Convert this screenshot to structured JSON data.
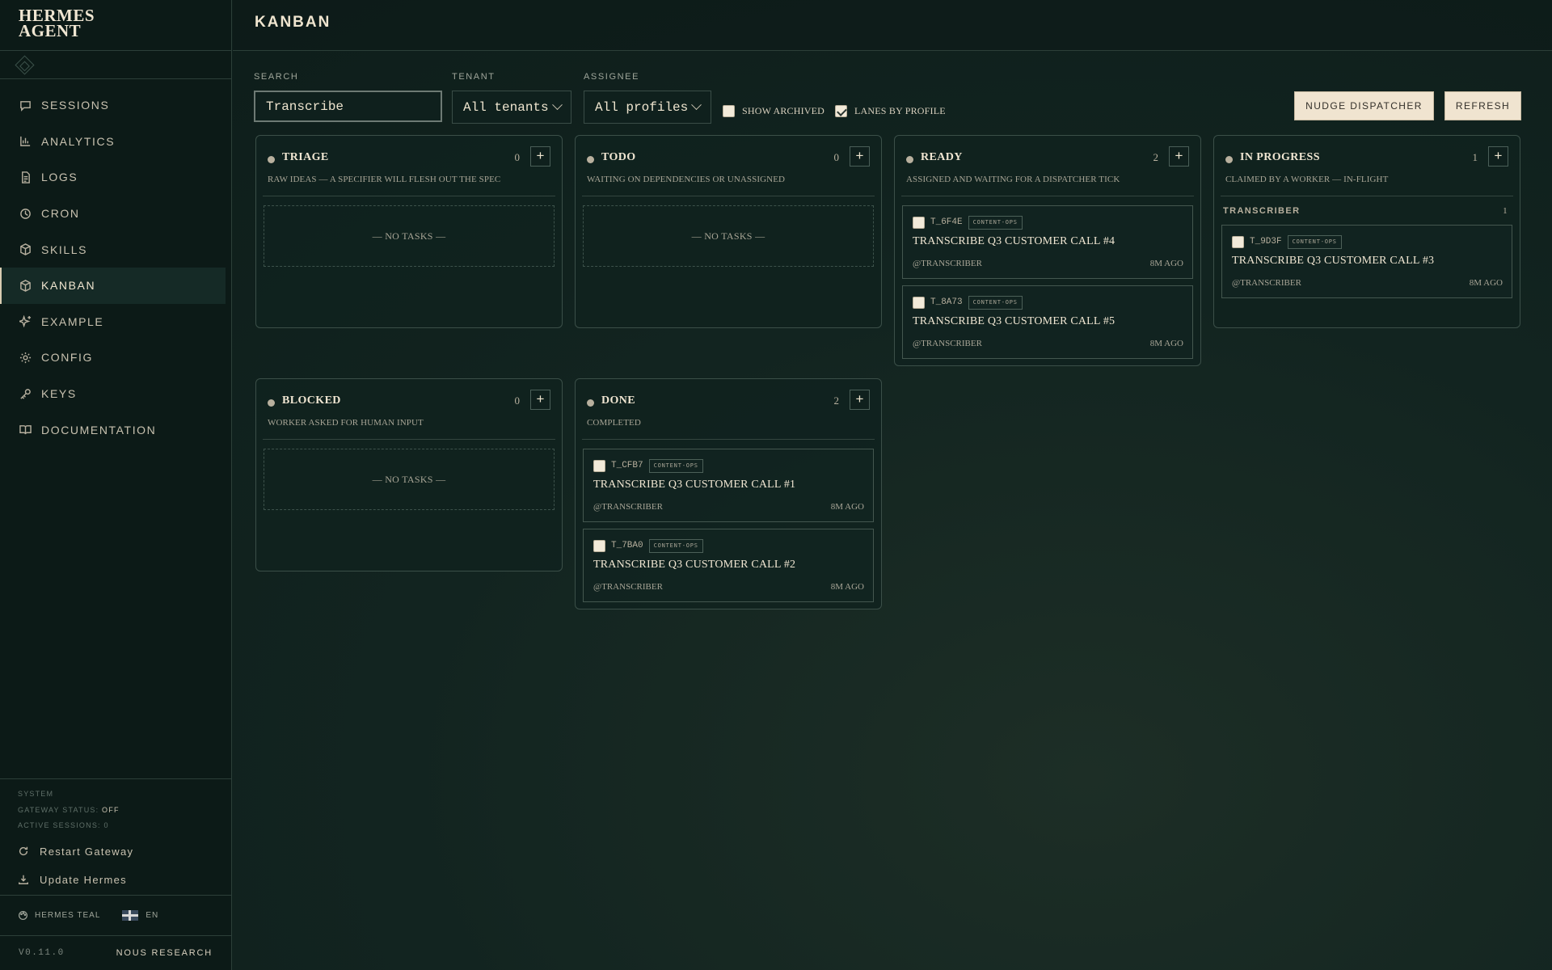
{
  "brand": {
    "line1": "HERMES",
    "line2": "AGENT"
  },
  "nav": {
    "sessions": "SESSIONS",
    "analytics": "ANALYTICS",
    "logs": "LOGS",
    "cron": "CRON",
    "skills": "SKILLS",
    "kanban": "KANBAN",
    "example": "EXAMPLE",
    "config": "CONFIG",
    "keys": "KEYS",
    "documentation": "DOCUMENTATION"
  },
  "system": {
    "heading": "SYSTEM",
    "gateway_label": "GATEWAY STATUS:",
    "gateway_value": "OFF",
    "sessions_label": "ACTIVE SESSIONS:",
    "sessions_value": "0",
    "restart": "Restart Gateway",
    "update": "Update Hermes"
  },
  "theme": {
    "name": "HERMES TEAL",
    "language": "EN"
  },
  "footer": {
    "version": "V0.11.0",
    "org": "NOUS RESEARCH"
  },
  "page": {
    "title": "KANBAN"
  },
  "filters": {
    "search_label": "SEARCH",
    "search_value": "Transcribe",
    "tenant_label": "TENANT",
    "tenant_value": "All tenants",
    "assignee_label": "ASSIGNEE",
    "assignee_value": "All profiles",
    "show_archived": "SHOW ARCHIVED",
    "show_archived_checked": false,
    "lanes_by_profile": "LANES BY PROFILE",
    "lanes_by_profile_checked": true,
    "nudge": "NUDGE DISPATCHER",
    "refresh": "REFRESH"
  },
  "columns": {
    "triage": {
      "title": "TRIAGE",
      "count": "0",
      "desc": "RAW IDEAS — A SPECIFIER WILL FLESH OUT THE SPEC",
      "empty": "— NO TASKS —"
    },
    "todo": {
      "title": "TODO",
      "count": "0",
      "desc": "WAITING ON DEPENDENCIES OR UNASSIGNED",
      "empty": "— NO TASKS —"
    },
    "ready": {
      "title": "READY",
      "count": "2",
      "desc": "ASSIGNED AND WAITING FOR A DISPATCHER TICK",
      "cards": [
        {
          "id": "T_6F4E",
          "tag": "CONTENT-OPS",
          "title": "TRANSCRIBE Q3 CUSTOMER CALL #4",
          "assignee": "@TRANSCRIBER",
          "age": "8M AGO"
        },
        {
          "id": "T_8A73",
          "tag": "CONTENT-OPS",
          "title": "TRANSCRIBE Q3 CUSTOMER CALL #5",
          "assignee": "@TRANSCRIBER",
          "age": "8M AGO"
        }
      ]
    },
    "in_progress": {
      "title": "IN PROGRESS",
      "count": "1",
      "desc": "CLAIMED BY A WORKER — IN-FLIGHT",
      "lane": {
        "name": "TRANSCRIBER",
        "count": "1"
      },
      "cards": [
        {
          "id": "T_9D3F",
          "tag": "CONTENT-OPS",
          "title": "TRANSCRIBE Q3 CUSTOMER CALL #3",
          "assignee": "@TRANSCRIBER",
          "age": "8M AGO"
        }
      ]
    },
    "blocked": {
      "title": "BLOCKED",
      "count": "0",
      "desc": "WORKER ASKED FOR HUMAN INPUT",
      "empty": "— NO TASKS —"
    },
    "done": {
      "title": "DONE",
      "count": "2",
      "desc": "COMPLETED",
      "cards": [
        {
          "id": "T_CFB7",
          "tag": "CONTENT-OPS",
          "title": "TRANSCRIBE Q3 CUSTOMER CALL #1",
          "assignee": "@TRANSCRIBER",
          "age": "8M AGO"
        },
        {
          "id": "T_7BA0",
          "tag": "CONTENT-OPS",
          "title": "TRANSCRIBE Q3 CUSTOMER CALL #2",
          "assignee": "@TRANSCRIBER",
          "age": "8M AGO"
        }
      ]
    }
  }
}
